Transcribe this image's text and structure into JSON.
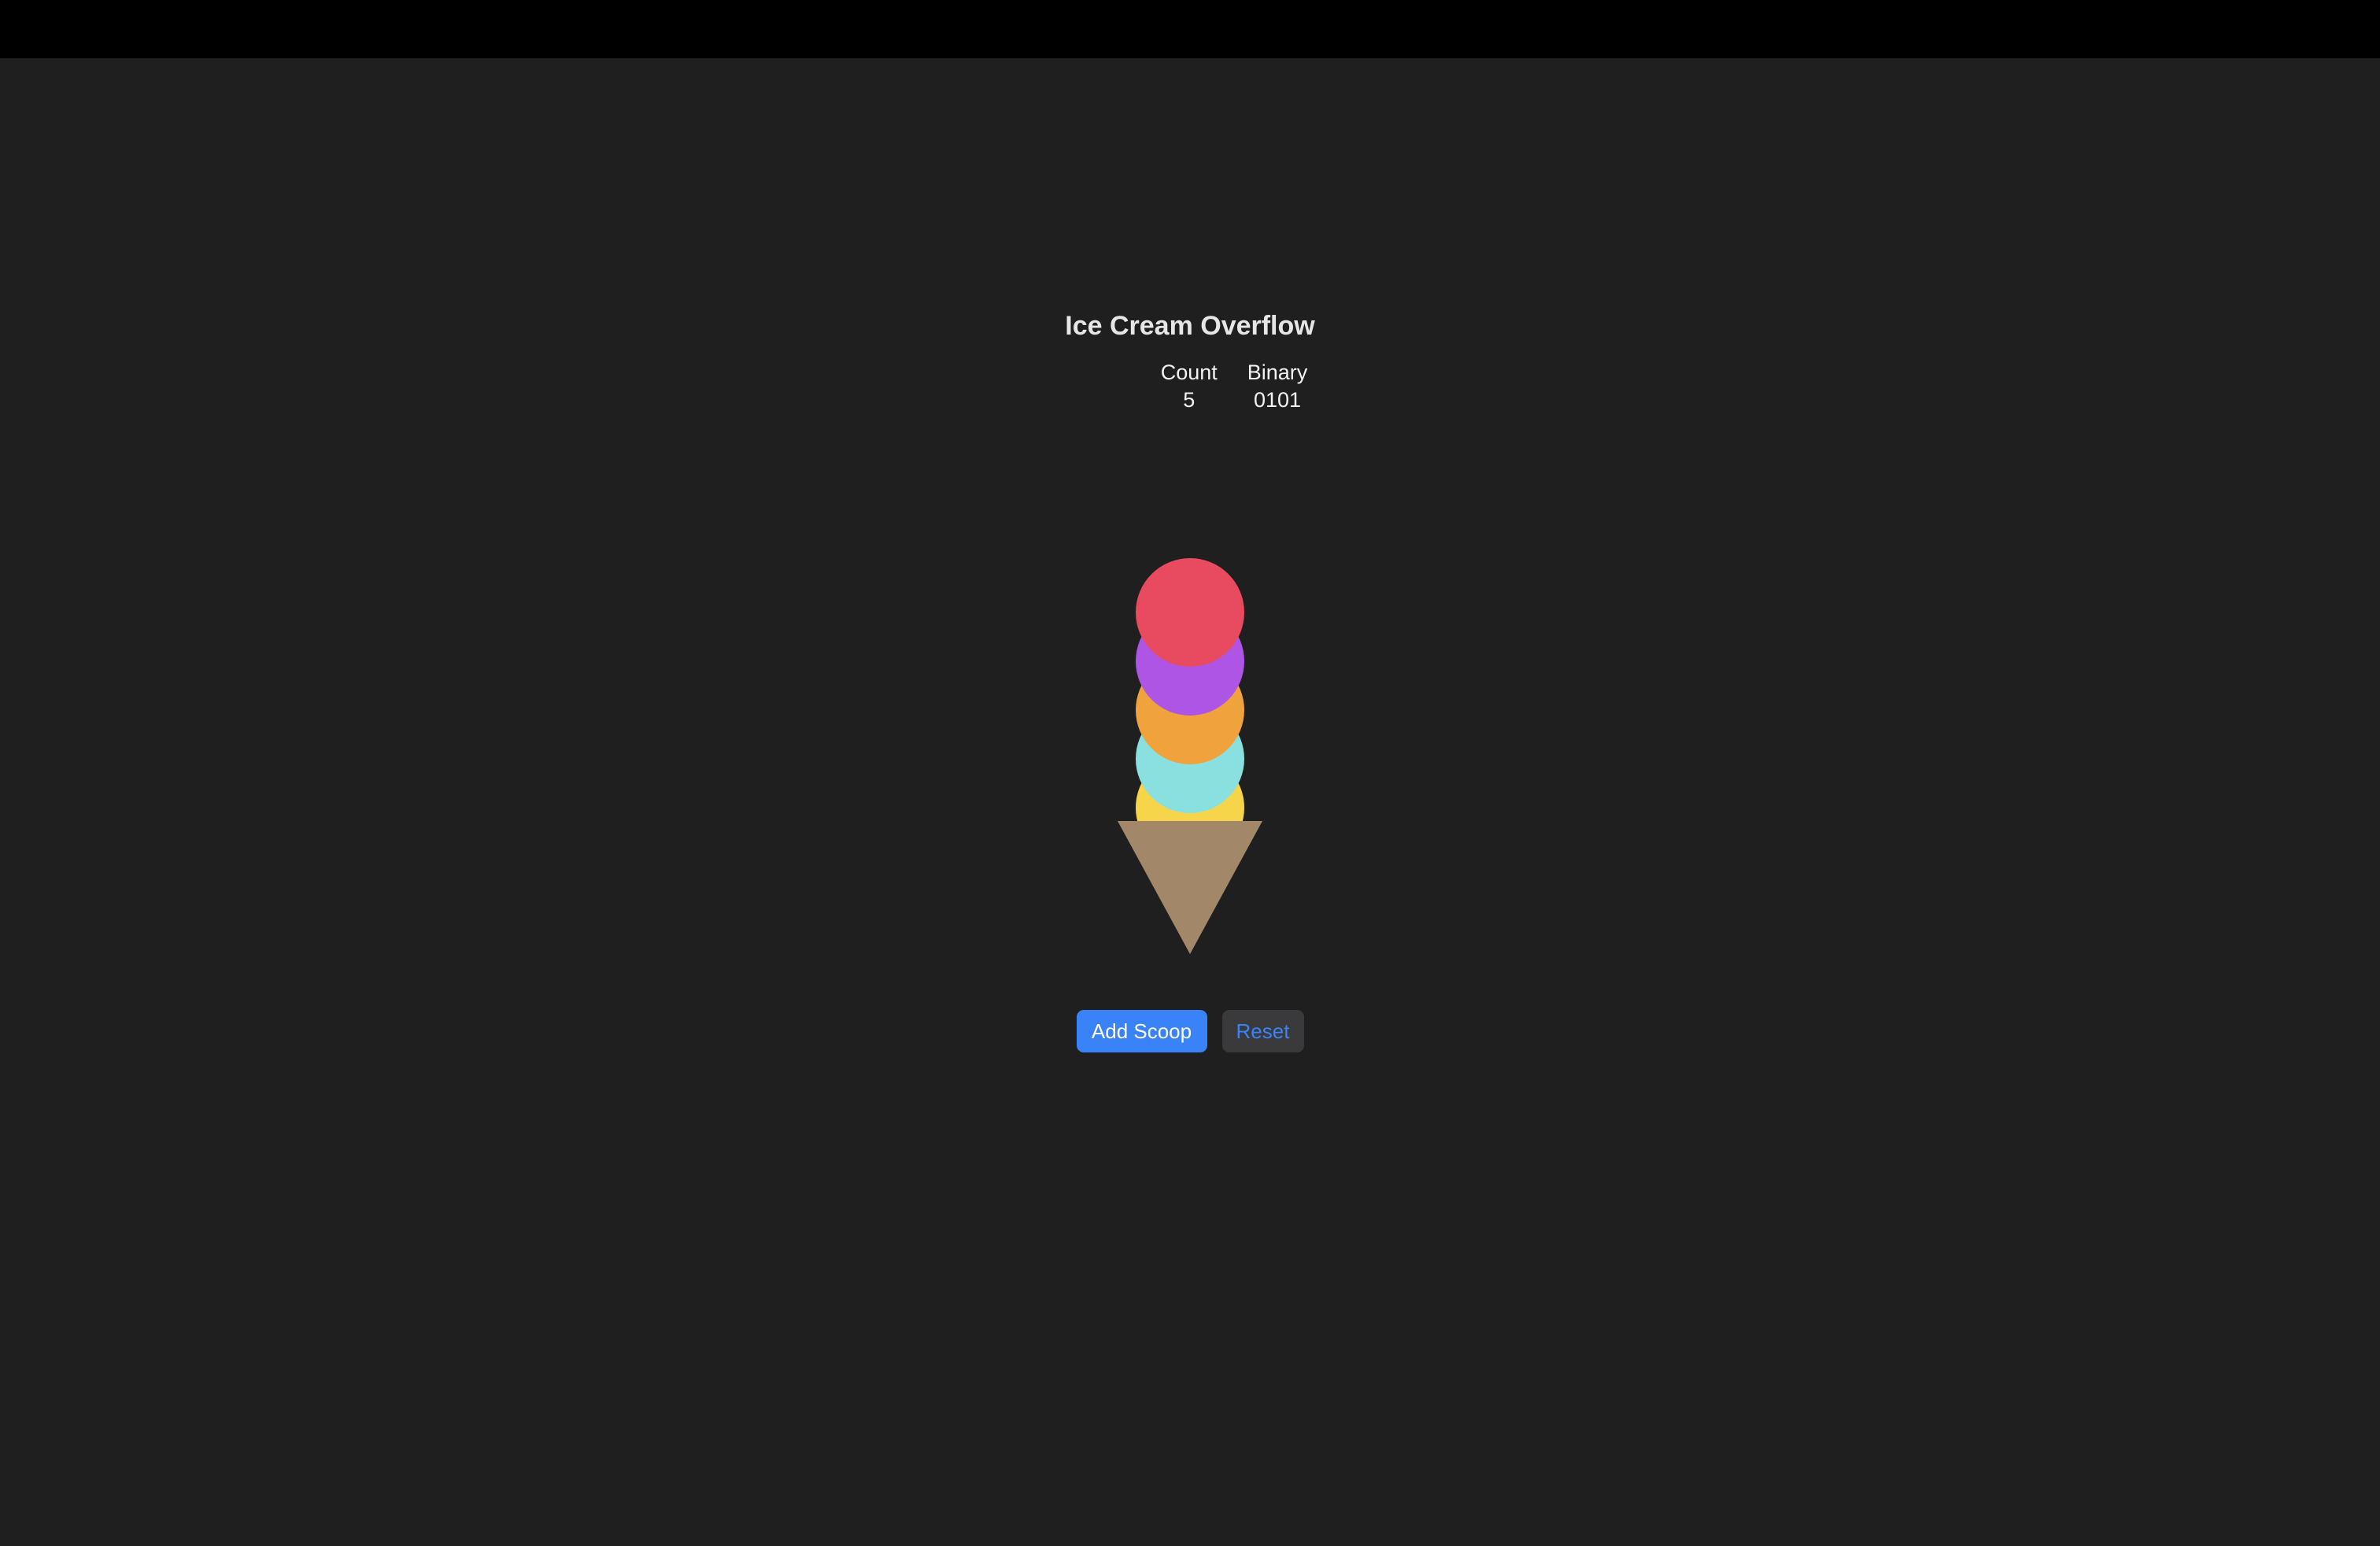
{
  "app": {
    "title": "Ice Cream Overflow"
  },
  "stats": {
    "count_label": "Count",
    "count_value": "5",
    "binary_label": "Binary",
    "binary_value": "0101"
  },
  "scoops": [
    {
      "flavor_color": "#f7d54a"
    },
    {
      "flavor_color": "#89e0df"
    },
    {
      "flavor_color": "#f0a33c"
    },
    {
      "flavor_color": "#af55e6"
    },
    {
      "flavor_color": "#e84a60"
    }
  ],
  "cone": {
    "color": "#a28868"
  },
  "controls": {
    "add_label": "Add Scoop",
    "reset_label": "Reset"
  },
  "colors": {
    "background": "#1f1f1f",
    "topbar": "#000000",
    "accent": "#3a82f7"
  }
}
